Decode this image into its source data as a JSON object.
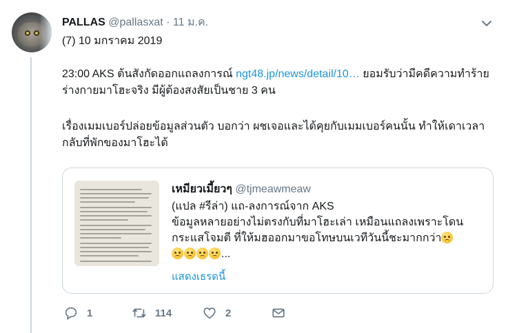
{
  "tweet": {
    "display_name": "PALLAS",
    "handle": "@pallasxat",
    "separator": "·",
    "date": "11 ม.ค.",
    "subline": "(7) 10 มกราคม 2019",
    "p1_before_link": "23:00 AKS ต้นสังกัดออกแถลงการณ์ ",
    "p1_link": "ngt48.jp/news/detail/10…",
    "p1_after_link": " ยอมรับว่ามีคดีความทำร้ายร่างกายมาโฮะจริง มีผู้ต้องสงสัยเป็นชาย 3 คน",
    "p2": "เรื่องเมมเบอร์ปล่อยข้อมูลส่วนตัว บอกว่า ผชเจอและได้คุยกับเมมเบอร์คนนั้น ทำให้เดาเวลากลับที่พักของมาโฮะได้"
  },
  "quote": {
    "display_name": "เหมียวเมี้ยวๆ",
    "handle": "@tjmeawmeaw",
    "text_line1": "(แปล #รีล่า) แถ-ลงการณ์จาก AKS",
    "text_line2": "ข้อมูลหลายอย่างไม่ตรงกับที่มาโฮะเล่า เหมือนแถลงเพราะโดนกระแสโจมตี ที่ให้มฮออกมาขอโทษบนเวทีวันนี้ชะมากกว่า",
    "ellipsis": "...",
    "show_thread": "แสดงเธรดนี้",
    "emoji_name": "slightly-frowning-face"
  },
  "actions": {
    "reply_count": "1",
    "retweet_count": "114",
    "like_count": "2"
  }
}
